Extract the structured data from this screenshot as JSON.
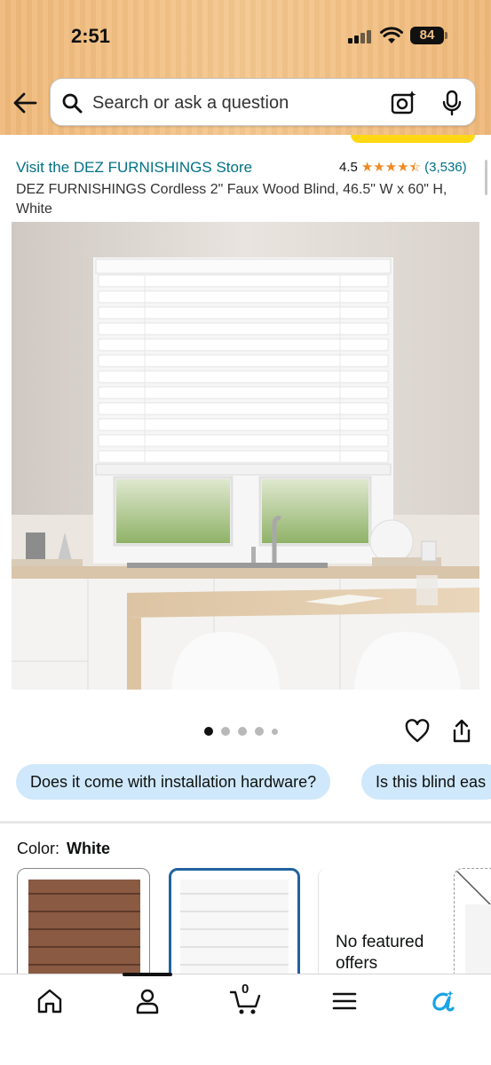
{
  "status_bar": {
    "time": "2:51",
    "battery": "84"
  },
  "search": {
    "placeholder": "Search or ask a question"
  },
  "product": {
    "store_link": "Visit the DEZ FURNISHINGS Store",
    "rating": "4.5",
    "stars": 4.5,
    "review_count": "(3,536)",
    "title": "DEZ FURNISHINGS Cordless 2\" Faux Wood Blind, 46.5\" W x 60\" H, White"
  },
  "gallery": {
    "image_count": 5,
    "active_index": 0
  },
  "questions": [
    "Does it come with installation hardware?",
    "Is this blind eas"
  ],
  "color": {
    "label": "Color:",
    "selected": "White",
    "no_offers_text": "No featured offers"
  },
  "cart": {
    "count": "0"
  },
  "colors": {
    "accent_link": "#007185",
    "star": "#f08a24",
    "chip_bg": "#cfe8fb",
    "selected_border": "#2162a1",
    "header": "#f4c78e"
  }
}
